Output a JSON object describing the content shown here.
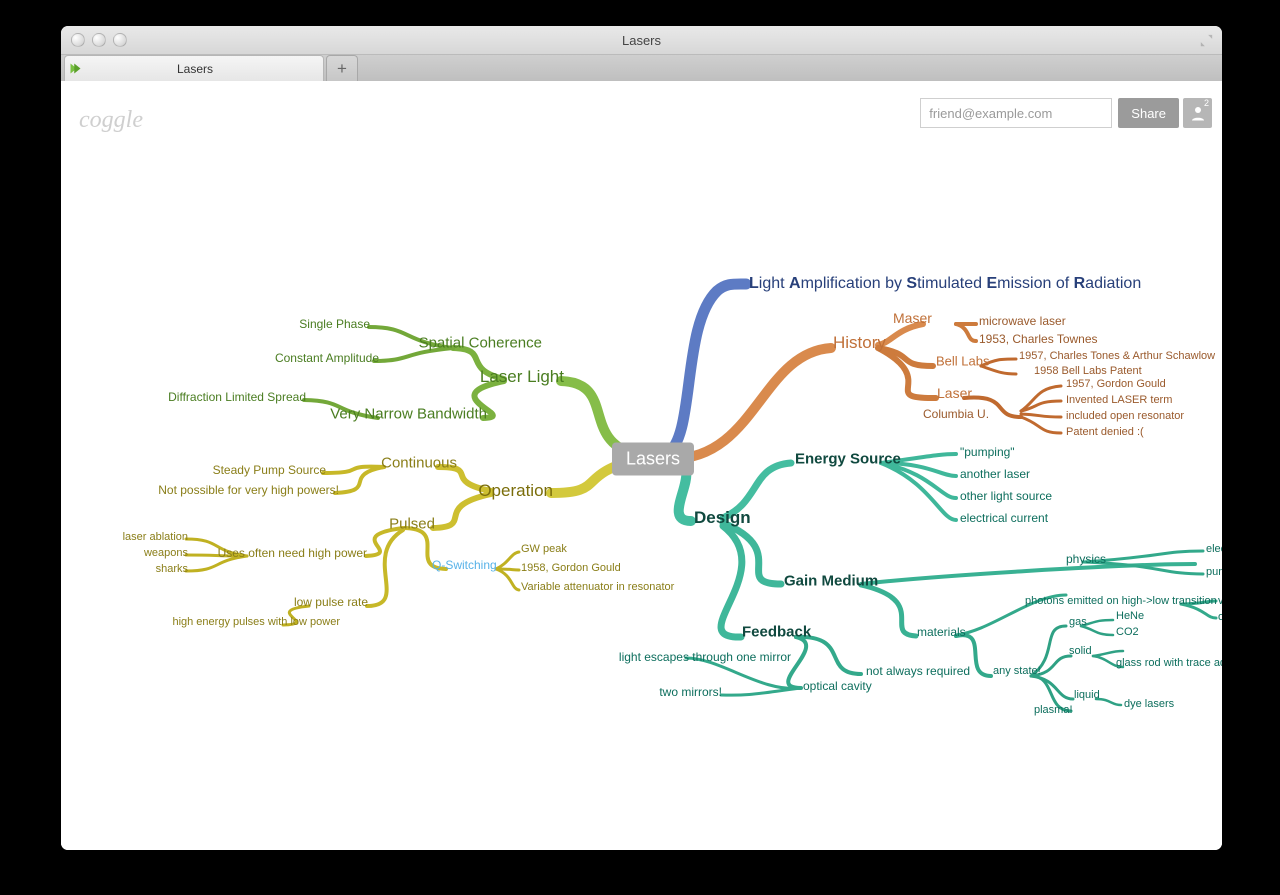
{
  "window": {
    "title": "Lasers"
  },
  "tab": {
    "label": "Lasers"
  },
  "app": {
    "name": "coggle"
  },
  "share": {
    "placeholder": "friend@example.com",
    "button": "Share",
    "count": "2"
  },
  "root": {
    "label": "Lasers"
  },
  "acronym": {
    "L": "L",
    "ight": "ight ",
    "A": "A",
    "mplification": "mplification by ",
    "S": "S",
    "timulated": "timulated ",
    "E": "E",
    "mission": "mission of ",
    "R": "R",
    "adiation": "adiation"
  },
  "history": {
    "label": "History",
    "maser": {
      "label": "Maser",
      "microwave": "microwave laser",
      "townes": "1953, Charles Townes"
    },
    "bell": {
      "label": "Bell Labs",
      "a": "1957, Charles Tones & Arthur Schawlow",
      "b": "1958 Bell Labs Patent"
    },
    "laser": {
      "label": "Laser",
      "columbia": "Columbia U.",
      "a": "1957, Gordon Gould",
      "b": "Invented LASER term",
      "c": "included open resonator",
      "d": "Patent denied :("
    }
  },
  "design": {
    "label": "Design",
    "energy": {
      "label": "Energy Source",
      "a": "\"pumping\"",
      "b": "another laser",
      "c": "other light source",
      "d": "electrical current"
    },
    "gain": {
      "label": "Gain Medium",
      "physics": {
        "label": "physics",
        "a": "electrons in disc",
        "b": "pumping energy",
        "c": "photons emitted on high->low transition",
        "v": "v",
        "o": "o"
      },
      "materials": {
        "label": "materials",
        "any": "any state!",
        "plasma": "plasma!",
        "gas": "gas",
        "solid": "solid",
        "liquid": "liquid",
        "hene": "HeNe",
        "co2": "CO2",
        "glass": "glass rod with trace additives",
        "dye": "dye lasers"
      }
    },
    "feedback": {
      "label": "Feedback",
      "a": "not always required",
      "b": "optical cavity",
      "c": "light escapes through one mirror",
      "d": "two mirrors!"
    }
  },
  "light": {
    "label": "Laser Light",
    "spatial": {
      "label": "Spatial Coherence",
      "a": "Single Phase",
      "b": "Constant Amplitude",
      "c": "Diffraction Limited Spread"
    },
    "bandwidth": {
      "label": "Very Narrow Bandwidth"
    }
  },
  "operation": {
    "label": "Operation",
    "continuous": {
      "label": "Continuous",
      "a": "Steady Pump Source",
      "b": "Not possible for very high powers!"
    },
    "pulsed": {
      "label": "Pulsed",
      "uses": "Uses often need high power",
      "u1": "laser ablation",
      "u2": "weapons",
      "u3": "sharks",
      "low": "low pulse rate",
      "low2": "high energy pulses with low power",
      "q": {
        "label": "Q-Switching",
        "a": "GW peak",
        "b": "1958, Gordon Gould",
        "c": "Variable attenuator in resonator"
      }
    }
  }
}
